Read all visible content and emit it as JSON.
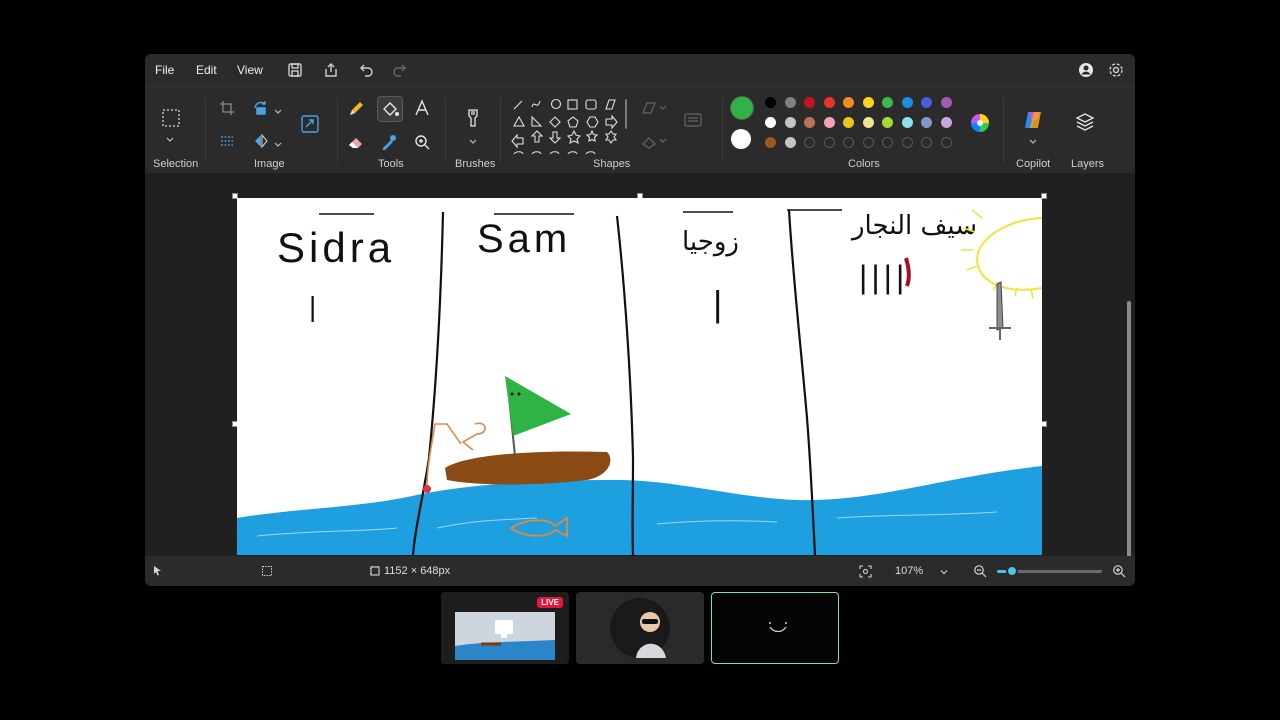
{
  "menu": {
    "file": "File",
    "edit": "Edit",
    "view": "View"
  },
  "ribbon": {
    "groups": {
      "selection": "Selection",
      "image": "Image",
      "tools": "Tools",
      "brushes": "Brushes",
      "shapes": "Shapes",
      "colors": "Colors",
      "copilot": "Copilot",
      "layers": "Layers"
    }
  },
  "colors": {
    "primary": "#2fb344",
    "secondary": "#ffffff",
    "palette_row1": [
      "#000000",
      "#7f7f7f",
      "#c3141f",
      "#e8322b",
      "#f58a1f",
      "#ffd21c",
      "#3cbb4a",
      "#1a8fe0",
      "#4b5bd6",
      "#a45ab5"
    ],
    "palette_row2": [
      "#ffffff",
      "#c3c3c3",
      "#b7745a",
      "#f6a0b5",
      "#f3c21a",
      "#efe48a",
      "#a7d63a",
      "#8ee0ea",
      "#7f97c9",
      "#c8a8dd"
    ],
    "palette_row3": [
      "#9a5a1c",
      "#c3c3c3"
    ]
  },
  "canvas": {
    "labels": {
      "col1": "Sidra",
      "col2": "Sam",
      "col3": "زوجيا",
      "col4": "سيف النجار",
      "tally1": "|",
      "tally3": "|",
      "tally4": "||||"
    }
  },
  "status": {
    "dimensions": "1152 × 648px",
    "zoom": "107%",
    "zoom_fraction": 0.14
  },
  "thumbs": {
    "live_badge": "LIVE"
  }
}
